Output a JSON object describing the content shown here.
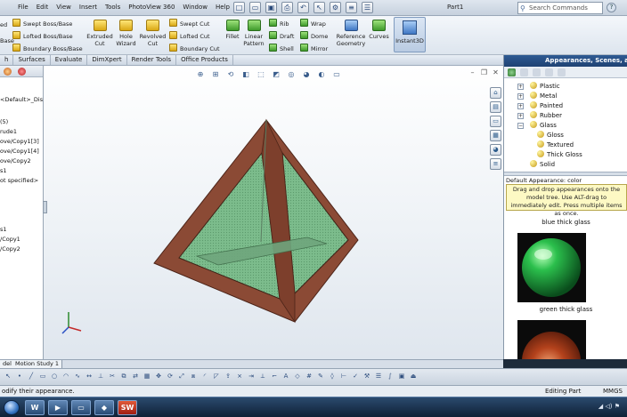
{
  "menu": [
    "File",
    "Edit",
    "View",
    "Insert",
    "Tools",
    "PhotoView 360",
    "Window",
    "Help"
  ],
  "document_title": "Part1",
  "search": {
    "placeholder": "Search Commands"
  },
  "ribbon": {
    "left_clip": [
      "ed",
      "Base"
    ],
    "boss_group": [
      "Swept Boss/Base",
      "Lofted Boss/Base",
      "Boundary Boss/Base"
    ],
    "cut_big": [
      {
        "label1": "Extruded",
        "label2": "Cut"
      },
      {
        "label1": "Hole",
        "label2": "Wizard"
      },
      {
        "label1": "Revolved",
        "label2": "Cut"
      }
    ],
    "cut_group": [
      "Swept Cut",
      "Lofted Cut",
      "Boundary Cut"
    ],
    "fillet": "Fillet",
    "linear_pattern": [
      "Linear",
      "Pattern"
    ],
    "features_col1": [
      "Rib",
      "Draft",
      "Shell"
    ],
    "features_col2": [
      "Wrap",
      "Dome",
      "Mirror"
    ],
    "reference_geometry": [
      "Reference",
      "Geometry"
    ],
    "curves": "Curves",
    "instant3d": "Instant3D"
  },
  "command_tabs": [
    "h",
    "Surfaces",
    "Evaluate",
    "DimXpert",
    "Render Tools",
    "Office Products"
  ],
  "feature_tree": [
    "<Default>_Disp",
    "(5)",
    "rude1",
    "ove/Copy1[3]",
    "ove/Copy1[4]",
    "ove/Copy2",
    "s1",
    "ot specified>",
    "",
    "",
    "",
    "",
    "s1",
    "/Copy1",
    "/Copy2"
  ],
  "task_pane": {
    "title": "Appearances, Scenes, and De",
    "tree": [
      "Plastic",
      "Metal",
      "Painted",
      "Rubber",
      "Glass"
    ],
    "glass_children": [
      "Gloss",
      "Textured",
      "Thick Gloss"
    ],
    "after": "Solid",
    "default_appearance": "Default Appearance: color",
    "tooltip": "Drag and drop appearances onto the model tree.  Use ALT-drag to immediately edit.  Press multiple items as once.",
    "swatches": [
      {
        "label": "blue thick glass",
        "color": "#2b5fae"
      },
      {
        "label": "green thick glass",
        "color": "#1f9a3a"
      },
      {
        "label": "",
        "color": "#8a2a14"
      }
    ]
  },
  "bottom_tabs": [
    "del",
    "Motion Study 1"
  ],
  "status": {
    "left": "odify their appearance.",
    "mode": "Editing Part",
    "units": "MMGS"
  },
  "model": {
    "frame_color": "#8b4a35",
    "glass_color": "#79b88a"
  }
}
